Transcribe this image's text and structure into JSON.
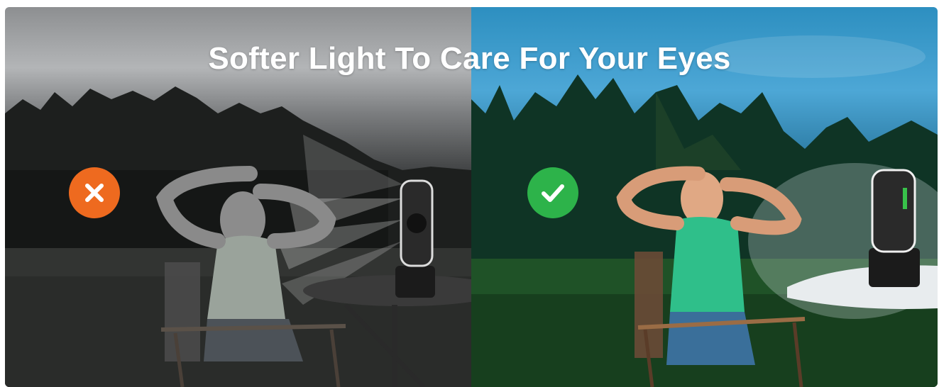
{
  "headline": "Softer Light To Care For Your Eyes",
  "comparison": {
    "left": {
      "status": "bad",
      "icon": "x-icon",
      "badge_color": "#ee6a1f",
      "tone": "grayscale"
    },
    "right": {
      "status": "good",
      "icon": "check-icon",
      "badge_color": "#2db34a",
      "tone": "color"
    }
  }
}
